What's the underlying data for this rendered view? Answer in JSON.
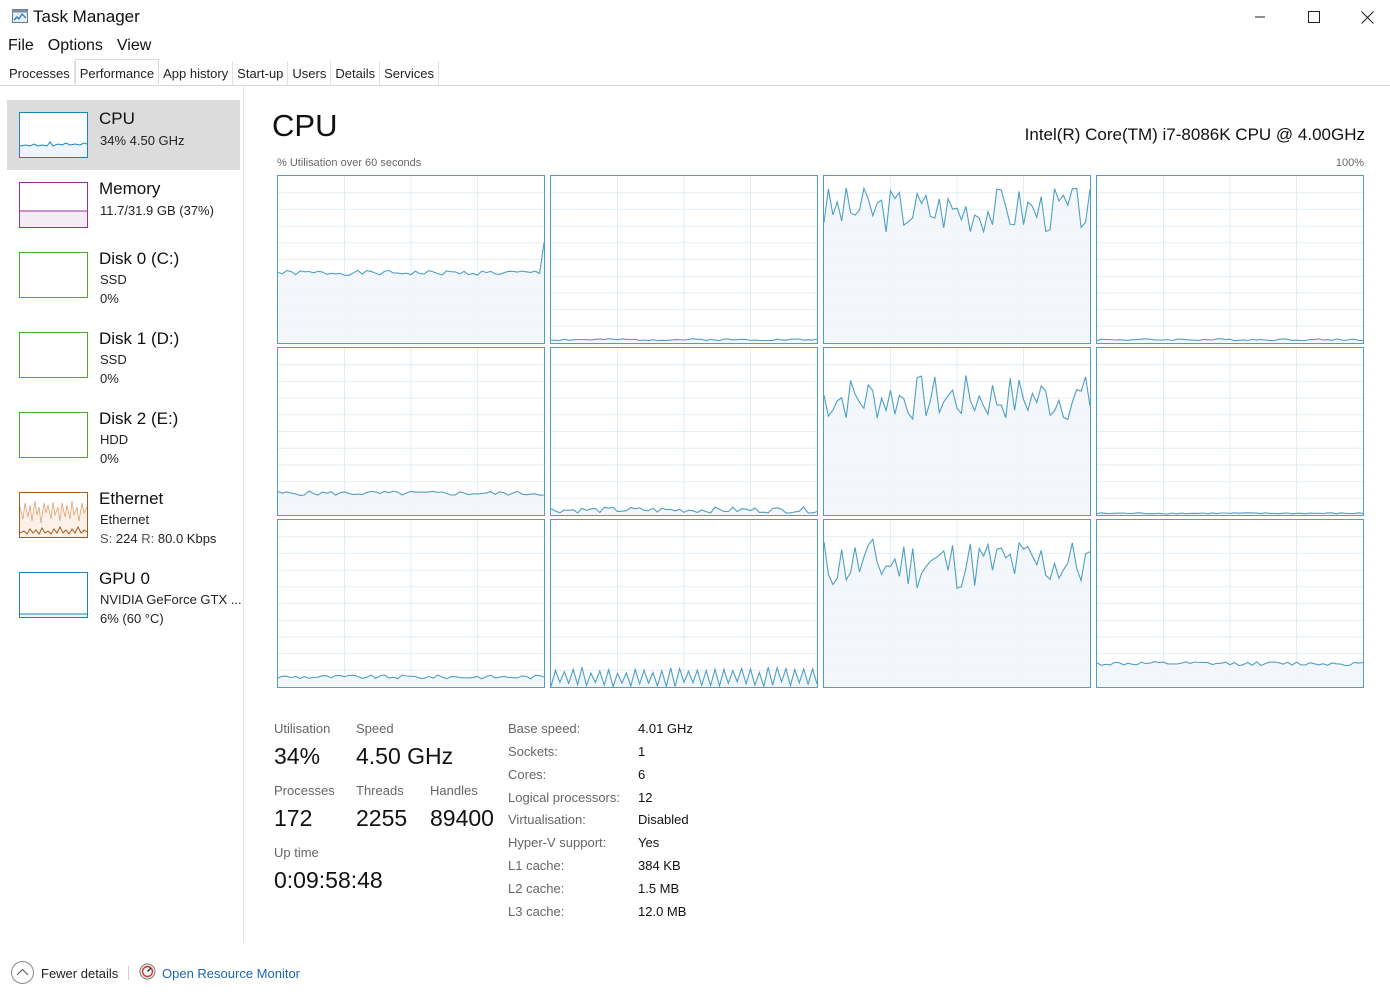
{
  "window": {
    "title": "Task Manager",
    "minimize_icon": "minimize-icon",
    "maximize_icon": "maximize-icon",
    "close_icon": "close-icon"
  },
  "menu": [
    "File",
    "Options",
    "View"
  ],
  "tabs": [
    "Processes",
    "Performance",
    "App history",
    "Start-up",
    "Users",
    "Details",
    "Services"
  ],
  "active_tab": "Performance",
  "sidebar": {
    "items": [
      {
        "name": "CPU",
        "line1": "34%  4.50 GHz",
        "line2": "",
        "color": "#1a86b8",
        "selected": true
      },
      {
        "name": "Memory",
        "line1": "11.7/31.9 GB (37%)",
        "line2": "",
        "color": "#9a2d9e",
        "selected": false
      },
      {
        "name": "Disk 0 (C:)",
        "line1": "SSD",
        "line2": "0%",
        "color": "#4cab2e",
        "selected": false
      },
      {
        "name": "Disk 1 (D:)",
        "line1": "SSD",
        "line2": "0%",
        "color": "#4cab2e",
        "selected": false
      },
      {
        "name": "Disk 2 (E:)",
        "line1": "HDD",
        "line2": "0%",
        "color": "#4cab2e",
        "selected": false
      },
      {
        "name": "Ethernet",
        "line1": "Ethernet",
        "line2_s_label": "S:",
        "line2_s_value": "224",
        "line2_r_label": "R:",
        "line2_r_value": "80.0 Kbps",
        "color": "#a65b1c",
        "selected": false
      },
      {
        "name": "GPU 0",
        "line1": "NVIDIA GeForce GTX ...",
        "line2": "6% (60 °C)",
        "color": "#1a86b8",
        "selected": false
      }
    ]
  },
  "main": {
    "title": "CPU",
    "cpu_model": "Intel(R) Core(TM) i7-8086K CPU @ 4.00GHz",
    "graph_label": "% Utilisation over 60 seconds",
    "graph_max": "100%",
    "line_color": "#4f9fc3",
    "fill_color": "#f1f6fa",
    "cores": [
      {
        "core": 1,
        "level": 0.42,
        "jitter": 0.015,
        "spike_end": true
      },
      {
        "core": 2,
        "level": 0.02,
        "jitter": 0.006
      },
      {
        "core": 3,
        "level": 0.8,
        "jitter": 0.14
      },
      {
        "core": 4,
        "level": 0.02,
        "jitter": 0.006
      },
      {
        "core": 5,
        "level": 0.13,
        "jitter": 0.014
      },
      {
        "core": 6,
        "level": 0.03,
        "jitter": 0.018
      },
      {
        "core": 7,
        "level": 0.7,
        "jitter": 0.14
      },
      {
        "core": 8,
        "level": 0.01,
        "jitter": 0.004
      },
      {
        "core": 9,
        "level": 0.06,
        "jitter": 0.012
      },
      {
        "core": 10,
        "level": 0.1,
        "jitter": 0.09,
        "sawtooth": true
      },
      {
        "core": 11,
        "level": 0.74,
        "jitter": 0.16
      },
      {
        "core": 12,
        "level": 0.14,
        "jitter": 0.012
      }
    ]
  },
  "stats": {
    "utilisation_label": "Utilisation",
    "utilisation_value": "34%",
    "speed_label": "Speed",
    "speed_value": "4.50 GHz",
    "processes_label": "Processes",
    "processes_value": "172",
    "threads_label": "Threads",
    "threads_value": "2255",
    "handles_label": "Handles",
    "handles_value": "89400",
    "uptime_label": "Up time",
    "uptime_value": "0:09:58:48"
  },
  "specs": [
    {
      "label": "Base speed:",
      "value": "4.01 GHz"
    },
    {
      "label": "Sockets:",
      "value": "1"
    },
    {
      "label": "Cores:",
      "value": "6"
    },
    {
      "label": "Logical processors:",
      "value": "12"
    },
    {
      "label": "Virtualisation:",
      "value": "Disabled"
    },
    {
      "label": "Hyper-V support:",
      "value": "Yes"
    },
    {
      "label": "L1 cache:",
      "value": "384 KB"
    },
    {
      "label": "L2 cache:",
      "value": "1.5 MB"
    },
    {
      "label": "L3 cache:",
      "value": "12.0 MB"
    }
  ],
  "footer": {
    "fewer_details": "Fewer details",
    "open_resource_monitor": "Open Resource Monitor"
  }
}
